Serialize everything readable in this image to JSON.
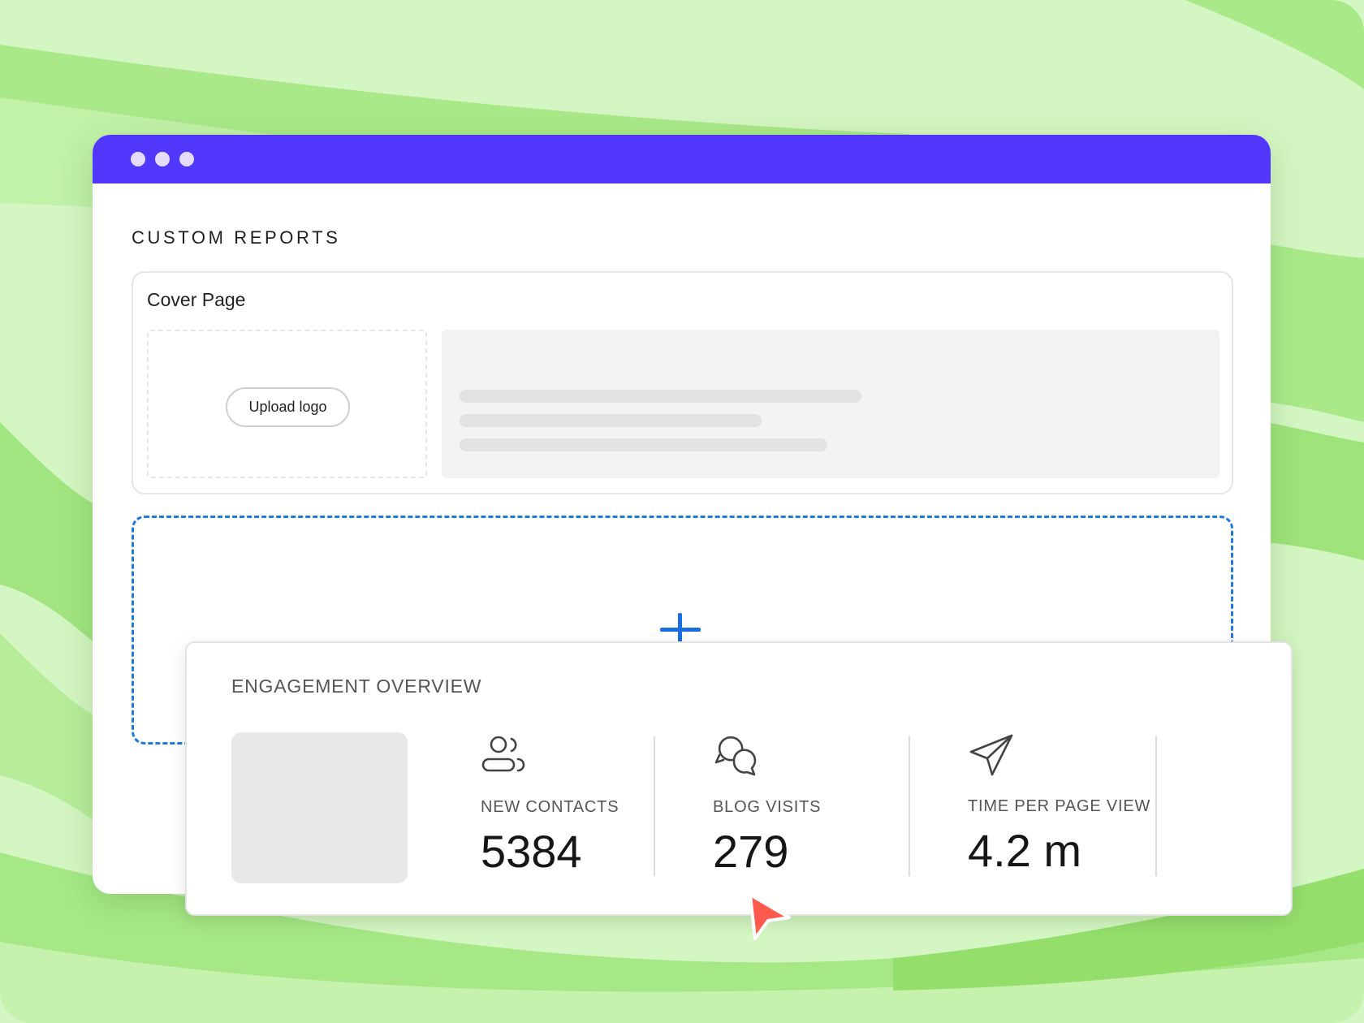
{
  "colors": {
    "background": "#d4f6c2",
    "accent_stripe": "#9ee47a",
    "titlebar": "#5136fb",
    "dropzone_border": "#1f7ae0",
    "cursor": "#ff5a4e"
  },
  "page": {
    "section_title": "CUSTOM REPORTS"
  },
  "cover": {
    "title": "Cover Page",
    "upload_label": "Upload logo"
  },
  "add_zone": {
    "icon": "plus-icon"
  },
  "overview": {
    "title": "ENGAGEMENT OVERVIEW",
    "metrics": [
      {
        "icon": "contacts-icon",
        "label": "NEW CONTACTS",
        "value": "5384"
      },
      {
        "icon": "chat-bubbles-icon",
        "label": "BLOG VISITS",
        "value": "279"
      },
      {
        "icon": "paper-plane-icon",
        "label": "TIME PER PAGE VIEW",
        "value": "4.2 m"
      }
    ]
  },
  "cursor": {
    "icon": "pointer-cursor-icon"
  }
}
